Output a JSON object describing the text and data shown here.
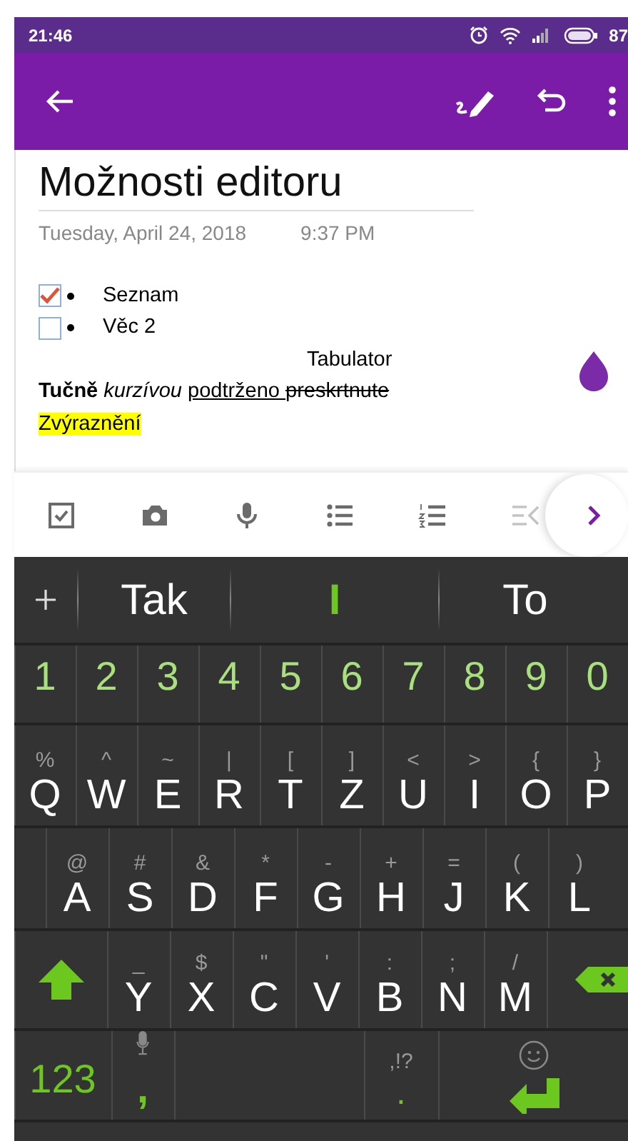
{
  "status_bar": {
    "time": "21:46",
    "battery": "87"
  },
  "note": {
    "title": "Možnosti editoru",
    "date": "Tuesday, April 24, 2018",
    "time": "9:37 PM",
    "checklist": [
      {
        "text": "Seznam",
        "checked": true
      },
      {
        "text": "Věc 2",
        "checked": false
      }
    ],
    "tab_text": "Tabulator",
    "formatted_line": [
      {
        "text": "Tučně ",
        "kind": "bold"
      },
      {
        "text": "kurzívou ",
        "kind": "italic"
      },
      {
        "text": "podtrženo ",
        "kind": "underline"
      },
      {
        "text": "preskrtnute",
        "kind": "strike"
      }
    ],
    "highlighted": "Zvýraznění"
  },
  "toolbar": [
    {
      "kind": "checkbox",
      "disabled": false
    },
    {
      "kind": "camera",
      "disabled": false
    },
    {
      "kind": "mic",
      "disabled": false
    },
    {
      "kind": "bullets",
      "disabled": false
    },
    {
      "kind": "numbers",
      "disabled": false
    },
    {
      "kind": "outdent",
      "disabled": true
    }
  ],
  "keyboard": {
    "suggestions": [
      {
        "text": "Tak",
        "selected": false
      },
      {
        "text": "I",
        "selected": true
      },
      {
        "text": "To",
        "selected": false
      }
    ],
    "rows": [
      [
        {
          "kind": "digit",
          "label": "1"
        },
        {
          "kind": "digit",
          "label": "2"
        },
        {
          "kind": "digit",
          "label": "3"
        },
        {
          "kind": "digit",
          "label": "4"
        },
        {
          "kind": "digit",
          "label": "5"
        },
        {
          "kind": "digit",
          "label": "6"
        },
        {
          "kind": "digit",
          "label": "7"
        },
        {
          "kind": "digit",
          "label": "8"
        },
        {
          "kind": "digit",
          "label": "9"
        },
        {
          "kind": "digit",
          "label": "0"
        }
      ],
      [
        {
          "kind": "char",
          "label": "Q",
          "alt": "%"
        },
        {
          "kind": "char",
          "label": "W",
          "alt": "^"
        },
        {
          "kind": "char",
          "label": "E",
          "alt": "~"
        },
        {
          "kind": "char",
          "label": "R",
          "alt": "|"
        },
        {
          "kind": "char",
          "label": "T",
          "alt": "["
        },
        {
          "kind": "char",
          "label": "Z",
          "alt": "]"
        },
        {
          "kind": "char",
          "label": "U",
          "alt": "<"
        },
        {
          "kind": "char",
          "label": "I",
          "alt": ">"
        },
        {
          "kind": "char",
          "label": "O",
          "alt": "{"
        },
        {
          "kind": "char",
          "label": "P",
          "alt": "}"
        }
      ],
      [
        {
          "kind": "char",
          "label": "A",
          "alt": "@"
        },
        {
          "kind": "char",
          "label": "S",
          "alt": "#"
        },
        {
          "kind": "char",
          "label": "D",
          "alt": "&"
        },
        {
          "kind": "char",
          "label": "F",
          "alt": "*"
        },
        {
          "kind": "char",
          "label": "G",
          "alt": "-"
        },
        {
          "kind": "char",
          "label": "H",
          "alt": "+"
        },
        {
          "kind": "char",
          "label": "J",
          "alt": "="
        },
        {
          "kind": "char",
          "label": "K",
          "alt": "("
        },
        {
          "kind": "char",
          "label": "L",
          "alt": ")"
        }
      ],
      [
        {
          "kind": "shift"
        },
        {
          "kind": "char",
          "label": "Y",
          "alt": "_"
        },
        {
          "kind": "char",
          "label": "X",
          "alt": "$"
        },
        {
          "kind": "char",
          "label": "C",
          "alt": "\""
        },
        {
          "kind": "char",
          "label": "V",
          "alt": "'"
        },
        {
          "kind": "char",
          "label": "B",
          "alt": ":"
        },
        {
          "kind": "char",
          "label": "N",
          "alt": ";"
        },
        {
          "kind": "char",
          "label": "M",
          "alt": "/"
        },
        {
          "kind": "backspace"
        }
      ],
      [
        {
          "kind": "mode",
          "label": "123"
        },
        {
          "kind": "comma",
          "label": ","
        },
        {
          "kind": "space"
        },
        {
          "kind": "period",
          "label": ".",
          "alt": ",!?"
        },
        {
          "kind": "enter"
        }
      ]
    ]
  }
}
